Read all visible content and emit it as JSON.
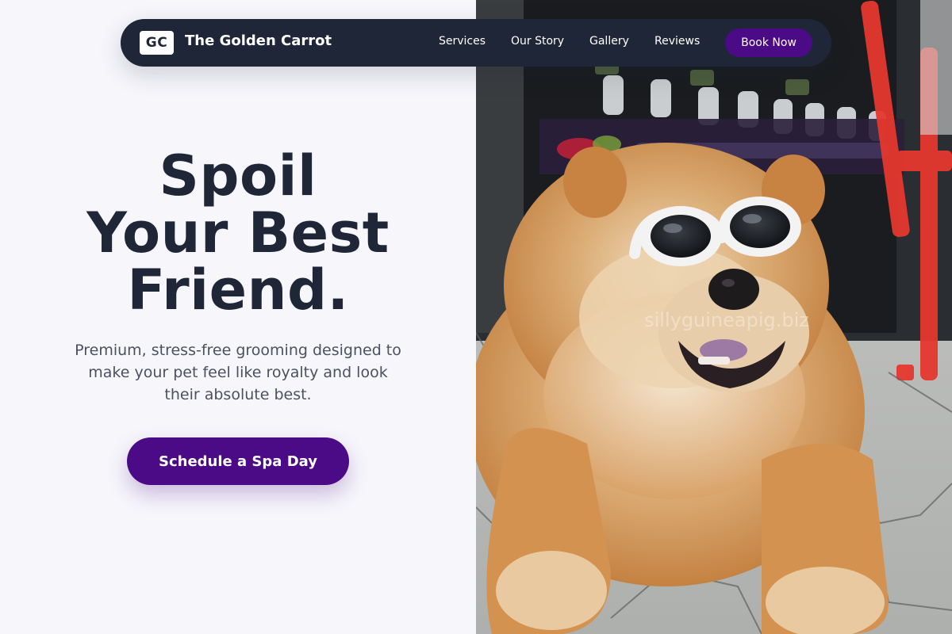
{
  "nav": {
    "logo_initials": "GC",
    "brand_name": "The Golden Carrot",
    "links": [
      "Services",
      "Our Story",
      "Gallery",
      "Reviews"
    ],
    "cta_label": "Book Now"
  },
  "hero": {
    "title_lines": [
      "Spoil",
      "Your Best",
      "Friend."
    ],
    "subtitle": "Premium, stress-free grooming designed to make your pet feel like royalty and look their absolute best.",
    "cta_label": "Schedule a Spa Day"
  },
  "photo": {
    "subject": "dog-wearing-sunglasses-photo",
    "watermark": "sillyguineapig.biz"
  },
  "colors": {
    "navy": "#1e2638",
    "purple": "#4b0b86",
    "background": "#f6f6fb",
    "fur": "#d2924f"
  }
}
